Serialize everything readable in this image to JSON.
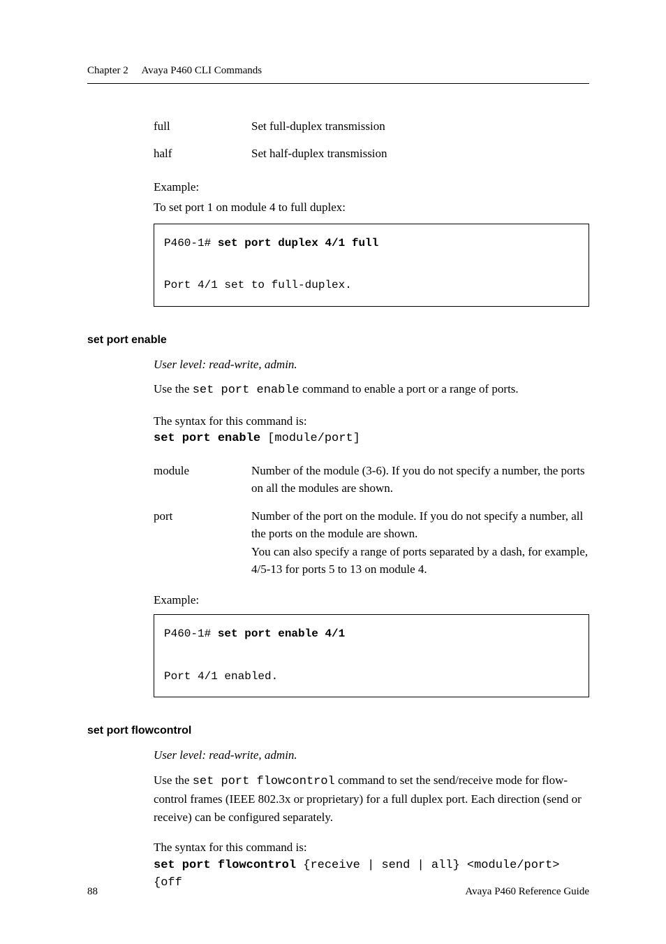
{
  "header": {
    "chapter": "Chapter 2",
    "title": "Avaya P460 CLI Commands"
  },
  "top_defs": [
    {
      "term": "full",
      "desc": "Set full-duplex transmission"
    },
    {
      "term": "half",
      "desc": "Set half-duplex transmission"
    }
  ],
  "top_example": {
    "label": "Example:",
    "intro": "To set port 1 on module 4 to full duplex:",
    "code_prompt": "P460-1# ",
    "code_cmd": "set port duplex 4/1 full",
    "code_output": "Port 4/1 set to full-duplex."
  },
  "sec_enable": {
    "title": "set port enable",
    "user_level": "User level: read-write, admin.",
    "use_pre": "Use the ",
    "use_cmd": "set port enable",
    "use_post": " command to enable a port or a range of ports.",
    "syntax_label": "The syntax for this command is:",
    "syntax_cmd": "set port enable",
    "syntax_arg": " [module/port]",
    "defs": [
      {
        "term": "module",
        "desc": "Number of the module (3-6). If you do not specify a number, the ports on all the modules are shown."
      },
      {
        "term": "port",
        "desc": "Number of the port on the module. If you do not specify a number, all the ports on the module are shown.\nYou can also specify a range of ports separated by a dash, for example, 4/5-13 for ports 5 to 13 on module 4."
      }
    ],
    "example_label": "Example:",
    "code_prompt": "P460-1# ",
    "code_cmd": "set port enable 4/1",
    "code_output": "Port 4/1 enabled."
  },
  "sec_flow": {
    "title": "set port flowcontrol",
    "user_level": "User level: read-write, admin.",
    "use_pre": "Use the ",
    "use_cmd": "set port flowcontrol",
    "use_post": " command to set the send/receive mode for flow-control frames (IEEE 802.3x or proprietary) for a full duplex port. Each direction (send or receive) can be configured separately.",
    "syntax_label": "The syntax for this command is:",
    "syntax_cmd": "set port flowcontrol",
    "syntax_arg": " {receive | send | all} <module/port> {off"
  },
  "footer": {
    "page": "88",
    "guide": "Avaya P460 Reference Guide"
  }
}
